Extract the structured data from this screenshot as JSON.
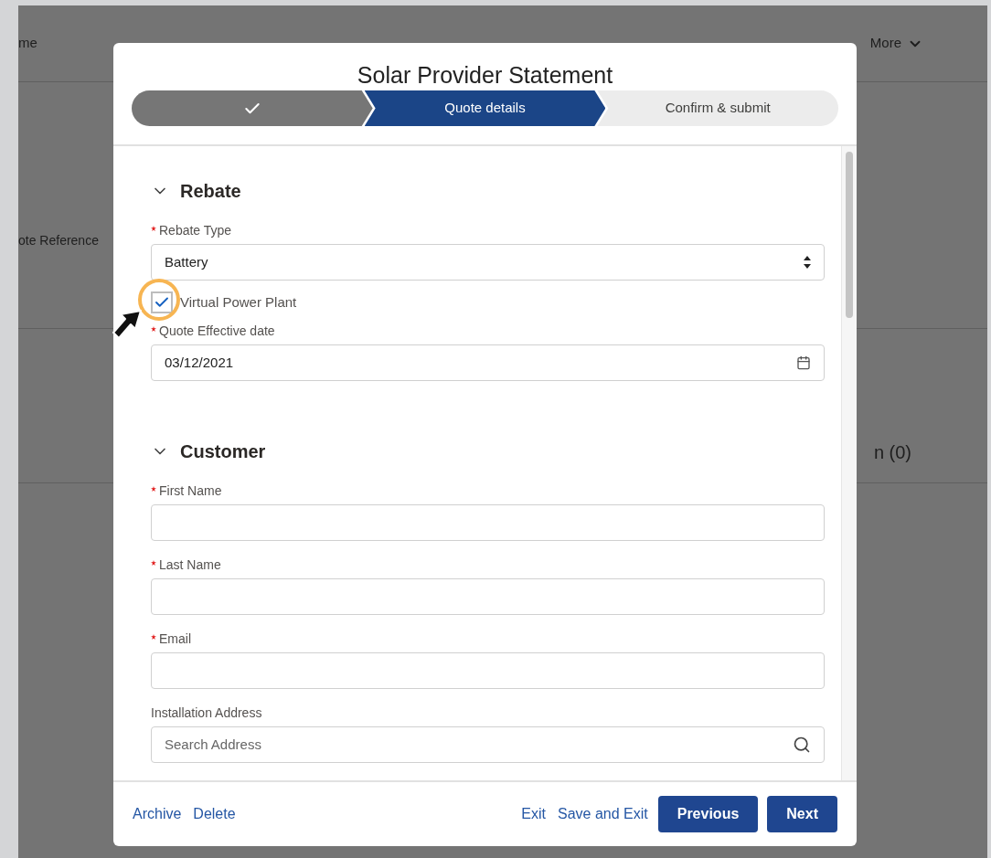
{
  "background_page": {
    "nav_items": [
      {
        "label": "me",
        "has_menu": false
      },
      {
        "label": "More",
        "has_menu": true
      }
    ],
    "field_label": "ote Reference",
    "related_list": "n (0)"
  },
  "modal": {
    "title": "Solar Provider Statement",
    "steps": [
      {
        "completed": true,
        "selected": false
      },
      {
        "label": "Quote details",
        "completed": false,
        "selected": true
      },
      {
        "label": "Confirm & submit",
        "completed": false,
        "selected": false
      }
    ],
    "sections": [
      {
        "title": "Rebate",
        "expanded": true,
        "fields": [
          {
            "kind": "select",
            "label": "Rebate Type",
            "required": true,
            "value": "Battery"
          },
          {
            "kind": "checkbox",
            "label": "Virtual Power Plant",
            "checked": true
          },
          {
            "kind": "date",
            "label": "Quote Effective date",
            "required": true,
            "value": "03/12/2021"
          }
        ]
      },
      {
        "title": "Customer",
        "expanded": true,
        "fields": [
          {
            "kind": "text",
            "label": "First Name",
            "required": true
          },
          {
            "kind": "text",
            "label": "Last Name",
            "required": true
          },
          {
            "kind": "text",
            "label": "Email",
            "required": true
          },
          {
            "kind": "search",
            "label": "Installation Address",
            "required": false,
            "placeholder": "Search Address"
          }
        ]
      }
    ],
    "footer": {
      "left_links": [
        "Archive",
        "Delete"
      ],
      "right_links": [
        "Exit",
        "Save and Exit"
      ],
      "buttons": [
        "Previous",
        "Next"
      ]
    }
  }
}
